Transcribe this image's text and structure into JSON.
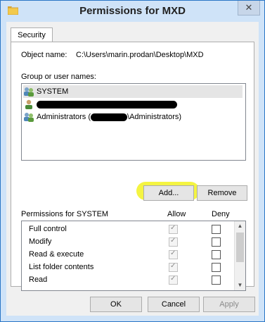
{
  "window": {
    "title": "Permissions for MXD",
    "close_label": "✕"
  },
  "tabs": [
    {
      "label": "Security"
    }
  ],
  "object": {
    "label": "Object name:",
    "value": "C:\\Users\\marin.prodan\\Desktop\\MXD"
  },
  "group_list": {
    "label": "Group or user names:",
    "items": [
      {
        "name": "SYSTEM",
        "icon": "users-group-icon",
        "selected": true
      },
      {
        "name": "",
        "icon": "user-icon",
        "redacted": true
      },
      {
        "prefix": "Administrators (",
        "suffix": "\\Administrators)",
        "icon": "users-group-icon"
      }
    ]
  },
  "buttons": {
    "add": "Add...",
    "remove": "Remove",
    "ok": "OK",
    "cancel": "Cancel",
    "apply": "Apply"
  },
  "permissions": {
    "label": "Permissions for SYSTEM",
    "allow_header": "Allow",
    "deny_header": "Deny",
    "rows": [
      {
        "name": "Full control",
        "allow": true,
        "deny": false
      },
      {
        "name": "Modify",
        "allow": true,
        "deny": false
      },
      {
        "name": "Read & execute",
        "allow": true,
        "deny": false
      },
      {
        "name": "List folder contents",
        "allow": true,
        "deny": false
      },
      {
        "name": "Read",
        "allow": true,
        "deny": false
      }
    ]
  },
  "colors": {
    "highlight": "#f3f32e",
    "title_border": "#2a76c6",
    "selection": "#e5e5e5"
  }
}
